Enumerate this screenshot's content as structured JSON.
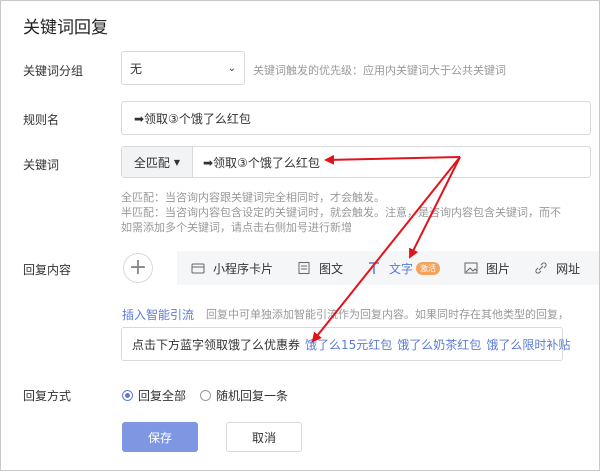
{
  "page_title": "关键词回复",
  "group": {
    "label": "关键词分组",
    "value": "无",
    "hint": "关键词触发的优先级：应用内关键词大于公共关键词"
  },
  "rule_name": {
    "label": "规则名",
    "value": "➡领取③个饿了么红包"
  },
  "keyword": {
    "label": "关键词",
    "match_label": "全匹配",
    "value": "➡领取③个饿了么红包"
  },
  "match_desc": {
    "line1": "全匹配：当咨询内容跟关键词完全相同时，才会触发。",
    "line2": "半匹配：当咨询内容包含设定的关键词时，就会触发。注意，是咨询内容包含关键词，而不",
    "line3": "如需添加多个关键词，请点击右侧加号进行新增"
  },
  "reply_content": {
    "label": "回复内容",
    "add_symbol": "+",
    "types": [
      {
        "label": "小程序卡片",
        "icon": "mini-program-card-icon"
      },
      {
        "label": "图文",
        "icon": "article-icon"
      },
      {
        "label": "文字",
        "icon": "text-icon",
        "badge": "激活",
        "active": true
      },
      {
        "label": "图片",
        "icon": "image-icon"
      },
      {
        "label": "网址",
        "icon": "link-icon"
      }
    ],
    "smart_link": "插入智能引流",
    "smart_hint": "回复中可单独添加智能引流作为回复内容。如果同时存在其他类型的回复，",
    "text_plain": "点击下方蓝字领取饿了么优惠券",
    "links": [
      "饿了么15元红包",
      "饿了么奶茶红包",
      "饿了么限时补贴"
    ]
  },
  "reply_mode": {
    "label": "回复方式",
    "option_all": "回复全部",
    "option_random": "随机回复一条"
  },
  "buttons": {
    "save": "保存",
    "cancel": "取消"
  },
  "colors": {
    "accent": "#5b7bd8",
    "save_button": "#7f97e3",
    "arrow": "#e0141b",
    "badge": "#f5a25d"
  }
}
